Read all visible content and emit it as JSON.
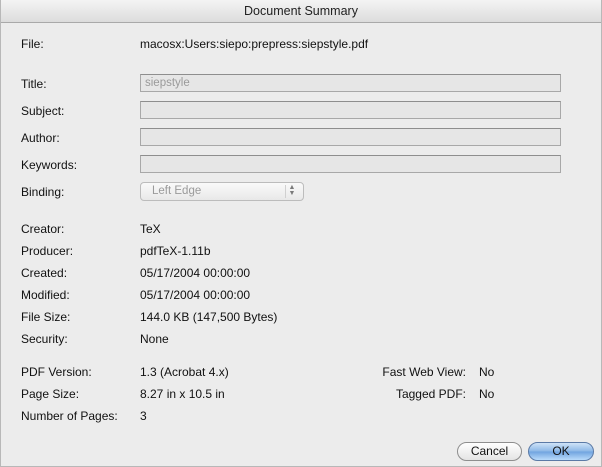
{
  "window": {
    "title": "Document Summary"
  },
  "file": {
    "label": "File:",
    "value": "macosx:Users:siepo:prepress:siepstyle.pdf"
  },
  "fields": {
    "title": {
      "label": "Title:",
      "value": "siepstyle"
    },
    "subject": {
      "label": "Subject:",
      "value": ""
    },
    "author": {
      "label": "Author:",
      "value": ""
    },
    "keywords": {
      "label": "Keywords:",
      "value": ""
    },
    "binding": {
      "label": "Binding:",
      "value": "Left Edge"
    }
  },
  "info": {
    "creator": {
      "label": "Creator:",
      "value": "TeX"
    },
    "producer": {
      "label": "Producer:",
      "value": "pdfTeX-1.11b"
    },
    "created": {
      "label": "Created:",
      "value": "05/17/2004 00:00:00"
    },
    "modified": {
      "label": "Modified:",
      "value": "05/17/2004 00:00:00"
    },
    "file_size": {
      "label": "File Size:",
      "value": "144.0 KB (147,500 Bytes)"
    },
    "security": {
      "label": "Security:",
      "value": "None"
    }
  },
  "pdf": {
    "version": {
      "label": "PDF Version:",
      "value": "1.3 (Acrobat 4.x)"
    },
    "page_size": {
      "label": "Page Size:",
      "value": "8.27 in x 10.5 in"
    },
    "num_pages": {
      "label": "Number of Pages:",
      "value": "3"
    },
    "fast_web_view": {
      "label": "Fast Web View:",
      "value": "No"
    },
    "tagged_pdf": {
      "label": "Tagged PDF:",
      "value": "No"
    }
  },
  "buttons": {
    "cancel": "Cancel",
    "ok": "OK"
  }
}
